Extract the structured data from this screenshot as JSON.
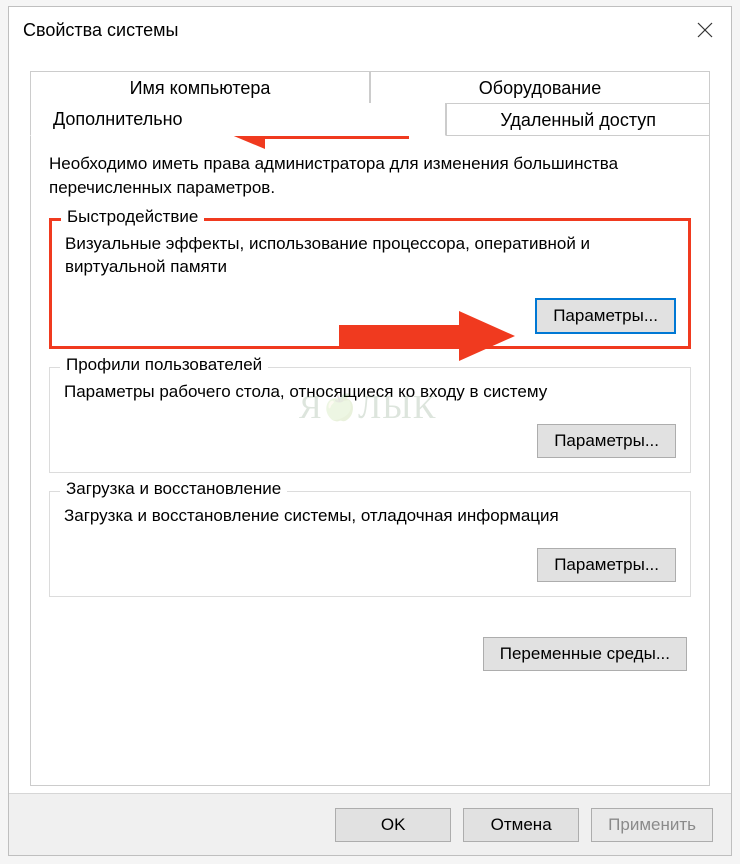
{
  "window": {
    "title": "Свойства системы"
  },
  "tabs": {
    "computer_name": "Имя компьютера",
    "hardware": "Оборудование",
    "advanced": "Дополнительно",
    "remote": "Удаленный доступ"
  },
  "intro": "Необходимо иметь права администратора для изменения большинства перечисленных параметров.",
  "performance": {
    "legend": "Быстродействие",
    "desc": "Визуальные эффекты, использование процессора, оперативной и виртуальной памяти",
    "button": "Параметры..."
  },
  "profiles": {
    "legend": "Профили пользователей",
    "desc": "Параметры рабочего стола, относящиеся ко входу в систему",
    "button": "Параметры..."
  },
  "startup": {
    "legend": "Загрузка и восстановление",
    "desc": "Загрузка и восстановление системы, отладочная информация",
    "button": "Параметры..."
  },
  "env_button": "Переменные среды...",
  "footer": {
    "ok": "OK",
    "cancel": "Отмена",
    "apply": "Применить"
  },
  "watermark": "ЯБЛЫК"
}
